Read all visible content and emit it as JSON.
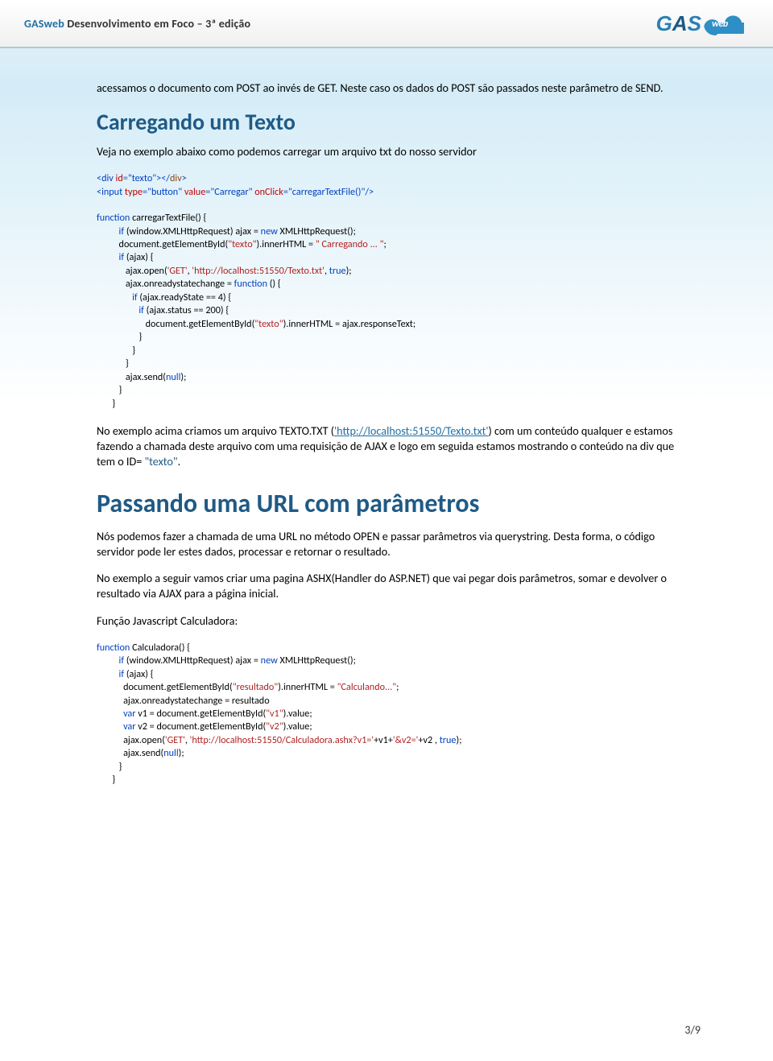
{
  "header": {
    "brand": "GASweb",
    "title_rest": " Desenvolvimento em Foco – 3ª edição"
  },
  "intro": {
    "p1": "acessamos o documento com POST ao invés de GET. Neste caso os dados do POST são passados neste parâmetro de SEND."
  },
  "section1": {
    "h": "Carregando um Texto",
    "p": "Veja no exemplo abaixo como podemos carregar um arquivo txt do nosso servidor",
    "html_line1_open": "<div",
    "html_line1_attr": " id",
    "html_line1_eq": "=\"texto\"",
    "html_line1_close1": "></",
    "html_line1_div2": "div",
    "html_line1_close2": ">",
    "html_line2_open": "<input",
    "html_line2_a1": " type",
    "html_line2_v1": "=\"button\"",
    "html_line2_a2": " value",
    "html_line2_v2": "=\"Carregar\"",
    "html_line2_a3": " onClick",
    "html_line2_v3": "=\"carregarTextFile()\"",
    "html_line2_close": "/>",
    "js": {
      "l1a": "function",
      "l1b": " carregarTextFile() {",
      "l2a": "          if",
      "l2b": " (window.XMLHttpRequest) ajax = ",
      "l2c": "new",
      "l2d": " XMLHttpRequest();",
      "l3a": "          document.getElementById(",
      "l3b": "\"texto\"",
      "l3c": ").innerHTML = ",
      "l3d": "\" Carregando ... \"",
      "l3e": ";",
      "l4a": "          if",
      "l4b": " (ajax) {",
      "l5a": "             ajax.open(",
      "l5b": "'GET'",
      "l5c": ", ",
      "l5d": "'http://localhost:51550/Texto.txt'",
      "l5e": ", ",
      "l5f": "true",
      "l5g": ");",
      "l6a": "             ajax.onreadystatechange = ",
      "l6b": "function",
      "l6c": " () {",
      "l7a": "                if",
      "l7b": " (ajax.readyState == 4) {",
      "l8a": "                   if",
      "l8b": " (ajax.status == 200) {",
      "l9a": "                      document.getElementById(",
      "l9b": "\"texto\"",
      "l9c": ").innerHTML = ajax.responseText;",
      "l10": "                   }",
      "l11": "                }",
      "l12": "             }",
      "l13a": "             ajax.send(",
      "l13b": "null",
      "l13c": ");",
      "l14": "          }",
      "l15": "       }"
    },
    "p2_a": "No exemplo acima criamos um arquivo TEXTO.TXT (",
    "p2_url": "'http://localhost:51550/Texto.txt'",
    "p2_b": ") com um conteúdo qualquer e estamos fazendo a chamada deste arquivo com uma requisição de AJAX e logo em seguida estamos mostrando o conteúdo na div que tem o ID= ",
    "p2_q": "\"texto\"",
    "p2_c": "."
  },
  "section2": {
    "h": "Passando uma URL com parâmetros",
    "p1": "Nós podemos fazer a chamada de uma URL no método OPEN e passar parâmetros via querystring. Desta forma, o código servidor pode ler estes dados, processar e retornar o resultado.",
    "p2": "No exemplo a seguir vamos criar uma pagina ASHX(Handler do ASP.NET) que vai pegar dois parâmetros, somar e devolver o resultado via AJAX para a página inicial.",
    "p3": "Função Javascript Calculadora:",
    "js": {
      "l1a": "function",
      "l1b": " Calculadora() {",
      "l2a": "          if",
      "l2b": " (window.XMLHttpRequest) ajax = ",
      "l2c": "new",
      "l2d": " XMLHttpRequest();",
      "l3a": "          if",
      "l3b": " (ajax) {",
      "l4a": "            document.getElementById(",
      "l4b": "\"resultado\"",
      "l4c": ").innerHTML = ",
      "l4d": "\"Calculando...\"",
      "l4e": ";",
      "l5": "            ajax.onreadystatechange = resultado",
      "l6a": "            var",
      "l6b": " v1 = document.getElementById(",
      "l6c": "\"v1\"",
      "l6d": ").value;",
      "l7a": "            var",
      "l7b": " v2 = document.getElementById(",
      "l7c": "\"v2\"",
      "l7d": ").value;",
      "l8a": "            ajax.open(",
      "l8b": "'GET'",
      "l8c": ", ",
      "l8d": "'http://localhost:51550/Calculadora.ashx?v1='",
      "l8e": "+v1+",
      "l8f": "'&v2='",
      "l8g": "+v2 , ",
      "l8h": "true",
      "l8i": ");",
      "l9a": "            ajax.send(",
      "l9b": "null",
      "l9c": ");",
      "l10": "          }",
      "l11": "       }"
    }
  },
  "footer": {
    "page": "3/9"
  }
}
